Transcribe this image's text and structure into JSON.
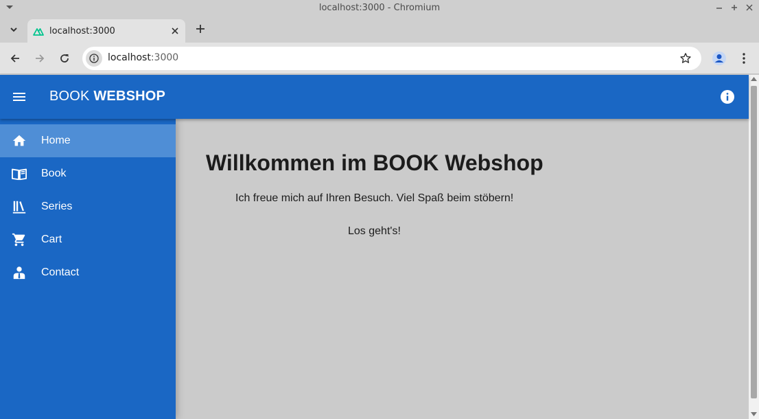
{
  "window": {
    "title": "localhost:3000 - Chromium"
  },
  "tabs": [
    {
      "title": "localhost:3000",
      "favicon": "nuxt-logo-icon"
    }
  ],
  "address_bar": {
    "host": "localhost",
    "port": ":3000"
  },
  "header": {
    "brand_light": "BOOK ",
    "brand_bold": "WEBSHOP"
  },
  "sidebar": {
    "items": [
      {
        "label": "Home",
        "icon": "home-icon",
        "active": true
      },
      {
        "label": "Book",
        "icon": "book-open-icon",
        "active": false
      },
      {
        "label": "Series",
        "icon": "bookshelf-icon",
        "active": false
      },
      {
        "label": "Cart",
        "icon": "cart-icon",
        "active": false
      },
      {
        "label": "Contact",
        "icon": "contact-person-icon",
        "active": false
      }
    ]
  },
  "main": {
    "heading": "Willkommen im BOOK Webshop",
    "welcome_text": "Ich freue mich auf Ihren Besuch. Viel Spaß beim stöbern!",
    "cta_text": "Los geht's!"
  },
  "colors": {
    "primary": "#1a67c4",
    "active_item": "#4f8ed6",
    "content_bg": "#cbcbcb"
  }
}
